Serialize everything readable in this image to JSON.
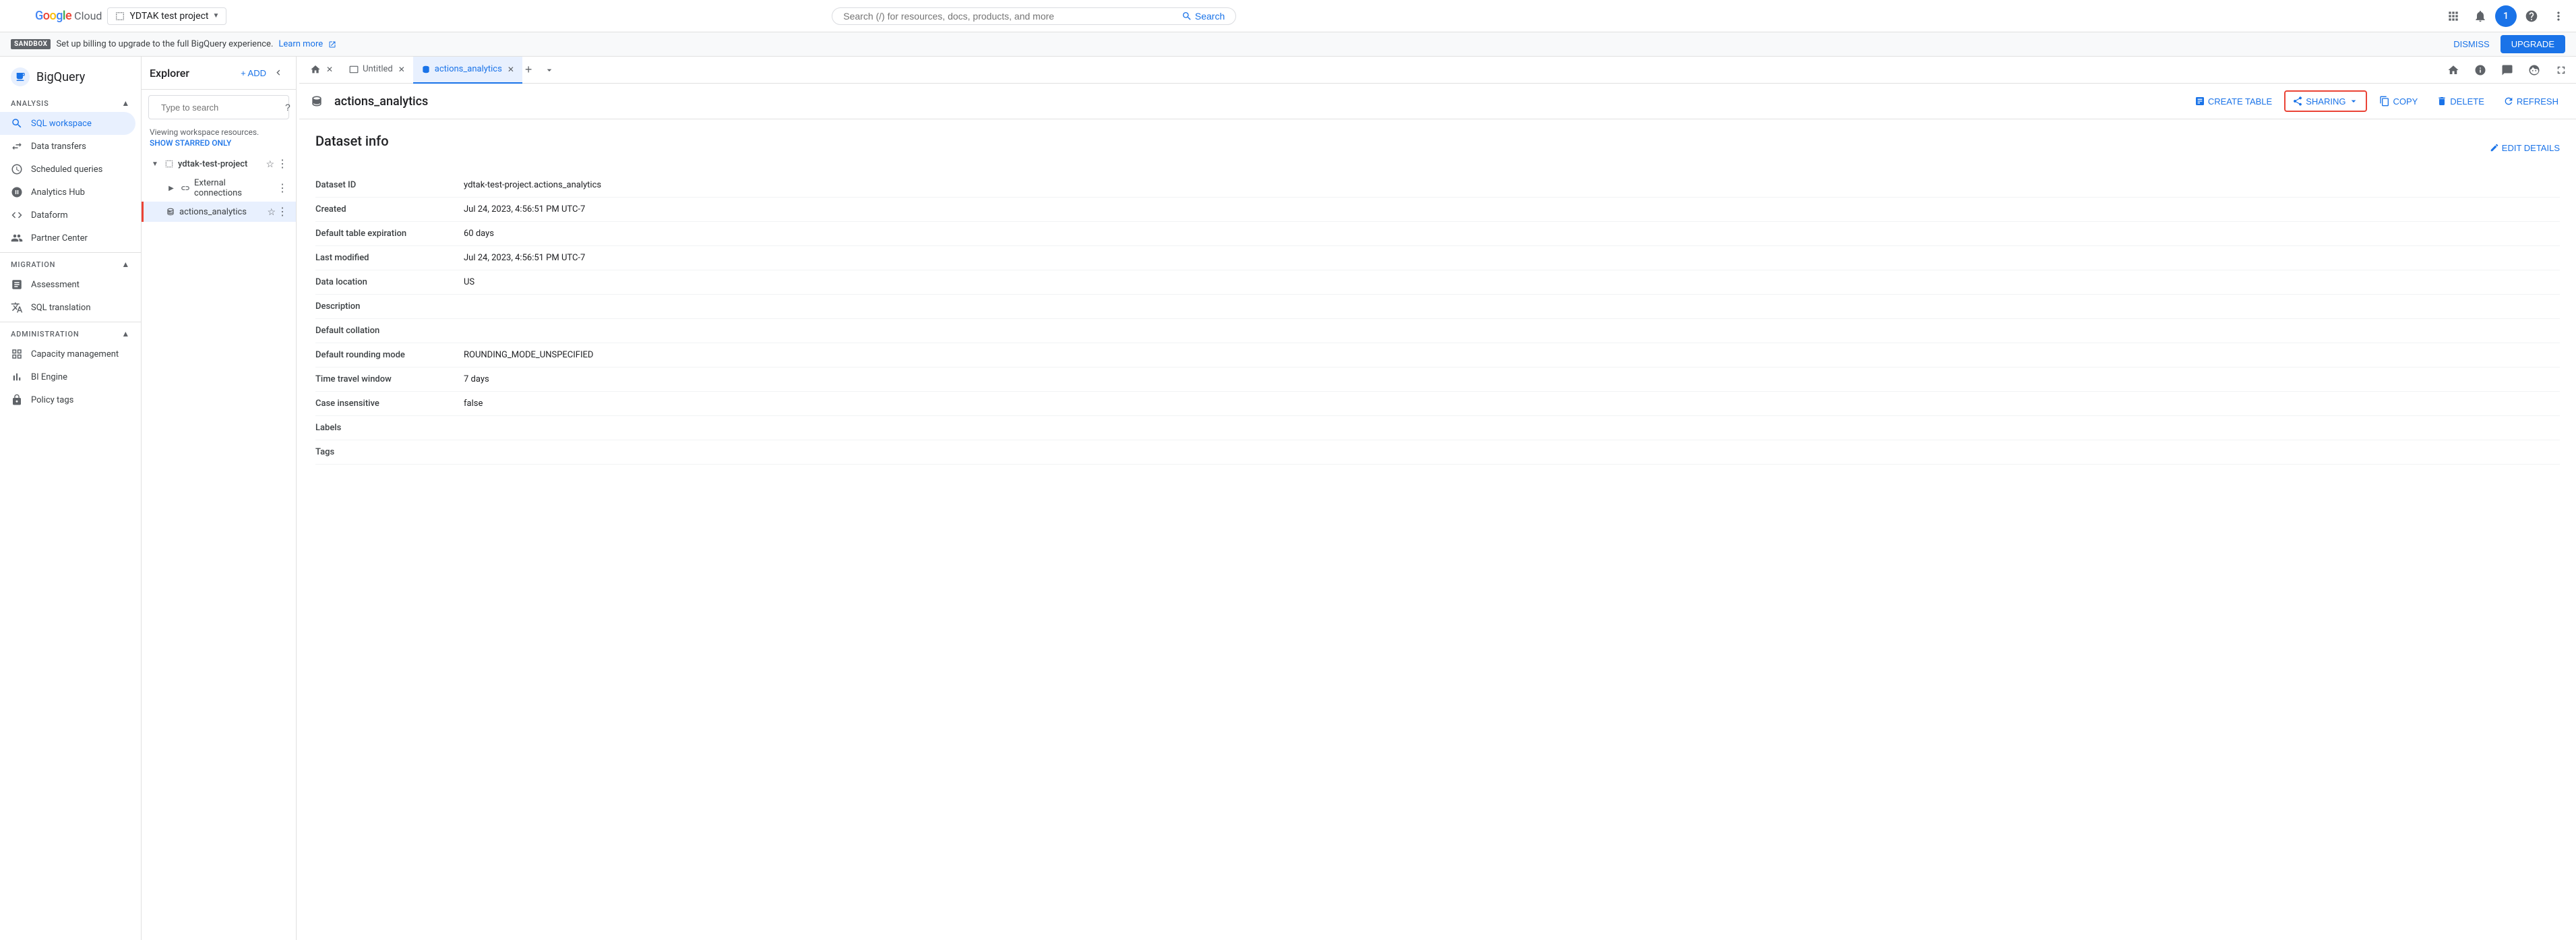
{
  "topbar": {
    "menu_icon": "menu",
    "logo_google": "Google",
    "logo_cloud": "Cloud",
    "project_name": "YDTAK test project",
    "search_placeholder": "Search (/) for resources, docs, products, and more",
    "search_label": "Search",
    "apps_icon": "apps",
    "notifications_icon": "notifications",
    "avatar_letter": "1",
    "help_icon": "help",
    "more_icon": "more_vert",
    "settings_icon": "settings"
  },
  "subheader": {
    "sandbox_badge": "SANDBOX",
    "message": "Set up billing to upgrade to the full BigQuery experience.",
    "link_text": "Learn more",
    "dismiss_label": "DISMISS",
    "upgrade_label": "UPGRADE"
  },
  "sidebar": {
    "header_title": "BigQuery",
    "sections": [
      {
        "name": "Analysis",
        "collapsed": false,
        "items": [
          {
            "id": "sql-workspace",
            "label": "SQL workspace",
            "icon": "search",
            "active": true
          },
          {
            "id": "data-transfers",
            "label": "Data transfers",
            "icon": "swap_horiz"
          },
          {
            "id": "scheduled-queries",
            "label": "Scheduled queries",
            "icon": "schedule"
          },
          {
            "id": "analytics-hub",
            "label": "Analytics Hub",
            "icon": "hub"
          },
          {
            "id": "dataform",
            "label": "Dataform",
            "icon": "code"
          },
          {
            "id": "partner-center",
            "label": "Partner Center",
            "icon": "handshake"
          }
        ]
      },
      {
        "name": "Migration",
        "collapsed": false,
        "items": [
          {
            "id": "assessment",
            "label": "Assessment",
            "icon": "assessment"
          },
          {
            "id": "sql-translation",
            "label": "SQL translation",
            "icon": "translate"
          }
        ]
      },
      {
        "name": "Administration",
        "collapsed": false,
        "items": [
          {
            "id": "capacity-management",
            "label": "Capacity management",
            "icon": "grid_view"
          },
          {
            "id": "bi-engine",
            "label": "BI Engine",
            "icon": "bar_chart"
          },
          {
            "id": "policy-tags",
            "label": "Policy tags",
            "icon": "lock"
          }
        ]
      }
    ]
  },
  "explorer": {
    "title": "Explorer",
    "add_label": "+ ADD",
    "search_placeholder": "Type to search",
    "workspace_text": "Viewing workspace resources.",
    "show_starred_label": "SHOW STARRED ONLY",
    "project": {
      "name": "ydtak-test-project",
      "items": [
        {
          "id": "external-connections",
          "label": "External connections",
          "icon": "connection",
          "selected": false,
          "indent": 1
        },
        {
          "id": "actions-analytics",
          "label": "actions_analytics",
          "icon": "dataset",
          "selected": true,
          "indent": 1
        }
      ]
    }
  },
  "tabs": [
    {
      "id": "home",
      "label": "",
      "icon": "home",
      "closeable": false,
      "active": false
    },
    {
      "id": "home-close",
      "label": "",
      "icon": "close",
      "closeable": true,
      "active": false
    },
    {
      "id": "untitled",
      "label": "Untitled",
      "icon": "",
      "closeable": true,
      "active": false
    },
    {
      "id": "actions-analytics-tab",
      "label": "actions_analytics",
      "icon": "",
      "closeable": true,
      "active": true
    }
  ],
  "dataset": {
    "icon": "dataset",
    "name": "actions_analytics",
    "toolbar": {
      "create_table_label": "CREATE TABLE",
      "sharing_label": "SHARING",
      "copy_label": "COPY",
      "delete_label": "DELETE",
      "refresh_label": "REFRESH"
    },
    "info_title": "Dataset info",
    "edit_details_label": "EDIT DETAILS",
    "fields": [
      {
        "label": "Dataset ID",
        "value": "ydtak-test-project.actions_analytics"
      },
      {
        "label": "Created",
        "value": "Jul 24, 2023, 4:56:51 PM UTC-7"
      },
      {
        "label": "Default table expiration",
        "value": "60 days"
      },
      {
        "label": "Last modified",
        "value": "Jul 24, 2023, 4:56:51 PM UTC-7"
      },
      {
        "label": "Data location",
        "value": "US"
      },
      {
        "label": "Description",
        "value": ""
      },
      {
        "label": "Default collation",
        "value": ""
      },
      {
        "label": "Default rounding mode",
        "value": "ROUNDING_MODE_UNSPECIFIED"
      },
      {
        "label": "Time travel window",
        "value": "7 days"
      },
      {
        "label": "Case insensitive",
        "value": "false"
      },
      {
        "label": "Labels",
        "value": ""
      },
      {
        "label": "Tags",
        "value": ""
      }
    ]
  },
  "colors": {
    "blue": "#1a73e8",
    "red": "#ea4335",
    "green": "#34a853",
    "yellow": "#fbbc04",
    "gray": "#5f6368",
    "light_blue_bg": "#e8f0fe"
  }
}
